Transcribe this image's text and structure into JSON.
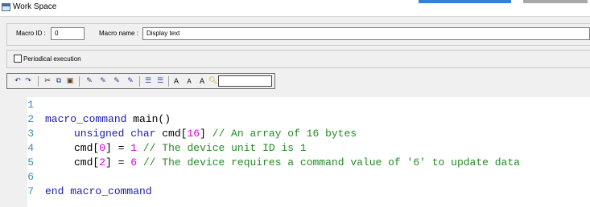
{
  "window": {
    "title": "Work Space"
  },
  "macro": {
    "id_label": "Macro ID :",
    "id_value": "0",
    "name_label": "Macro name :",
    "name_value": "Display text",
    "periodical_label": "Periodical execution",
    "periodical_checked": false
  },
  "toolbar": {
    "icons": [
      "undo-icon",
      "redo-icon",
      "cut-icon",
      "copy-icon",
      "paste-icon",
      "toggle-bookmark-icon",
      "next-bookmark-icon",
      "previous-bookmark-icon",
      "clear-bookmarks-icon",
      "indent-icon",
      "outdent-icon",
      "increase-font-icon",
      "decrease-font-icon",
      "default-font-icon",
      "find-icon"
    ],
    "font_a1": "A",
    "font_a2": "A",
    "font_a3": "A",
    "search_value": ""
  },
  "editor": {
    "line_numbers": [
      "1",
      "2",
      "3",
      "4",
      "5",
      "6",
      "7"
    ],
    "line2_kw": "macro_command",
    "line2_rest": " main()",
    "line3_kw": "unsigned char",
    "line3_a": " cmd[",
    "line3_num": "16",
    "line3_b": "] ",
    "line3_comment": "// An array of 16 bytes",
    "line4_a": "cmd[",
    "line4_num1": "0",
    "line4_b": "] = ",
    "line4_num2": "1",
    "line4_sp": " ",
    "line4_comment": "// The device unit ID is 1",
    "line5_a": "cmd[",
    "line5_num1": "2",
    "line5_b": "] = ",
    "line5_num2": "6",
    "line5_sp": " ",
    "line5_comment": "// The device requires a command value of '6' to update data",
    "line7_kw": "end macro_command"
  },
  "colors": {
    "keyword": "#1a1ab2",
    "number": "#e000e0",
    "comment": "#228b22",
    "line_number": "#3b8fb1"
  }
}
